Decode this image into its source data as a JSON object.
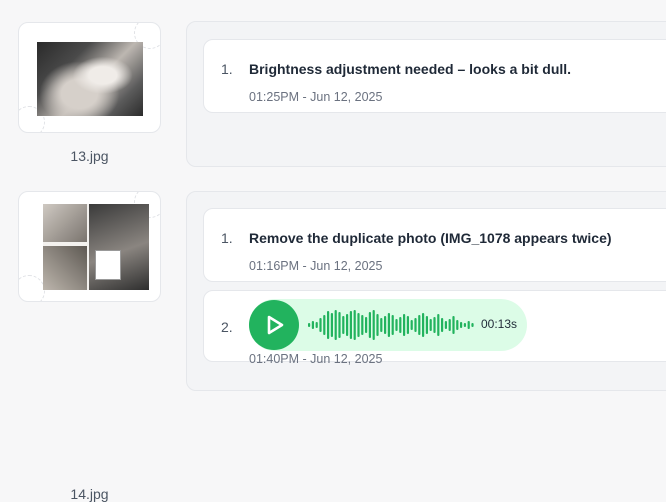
{
  "colors": {
    "accent_green": "#22b35e",
    "voice_bg": "#dcfce7",
    "panel_bg": "#f3f4f6"
  },
  "items": [
    {
      "file_name": "13.jpg",
      "comments": [
        {
          "number": "1.",
          "type": "text",
          "text": "Brightness adjustment needed – looks a bit dull.",
          "time": "01:25PM - Jun 12, 2025"
        }
      ]
    },
    {
      "file_name": "14.jpg",
      "comments": [
        {
          "number": "1.",
          "type": "text",
          "text": "Remove the duplicate photo (IMG_1078 appears twice)",
          "time": "01:16PM - Jun 12, 2025"
        },
        {
          "number": "2.",
          "type": "voice",
          "duration": "00:13s",
          "time": "01:40PM - Jun 12, 2025",
          "icon": "play-icon"
        }
      ]
    }
  ]
}
